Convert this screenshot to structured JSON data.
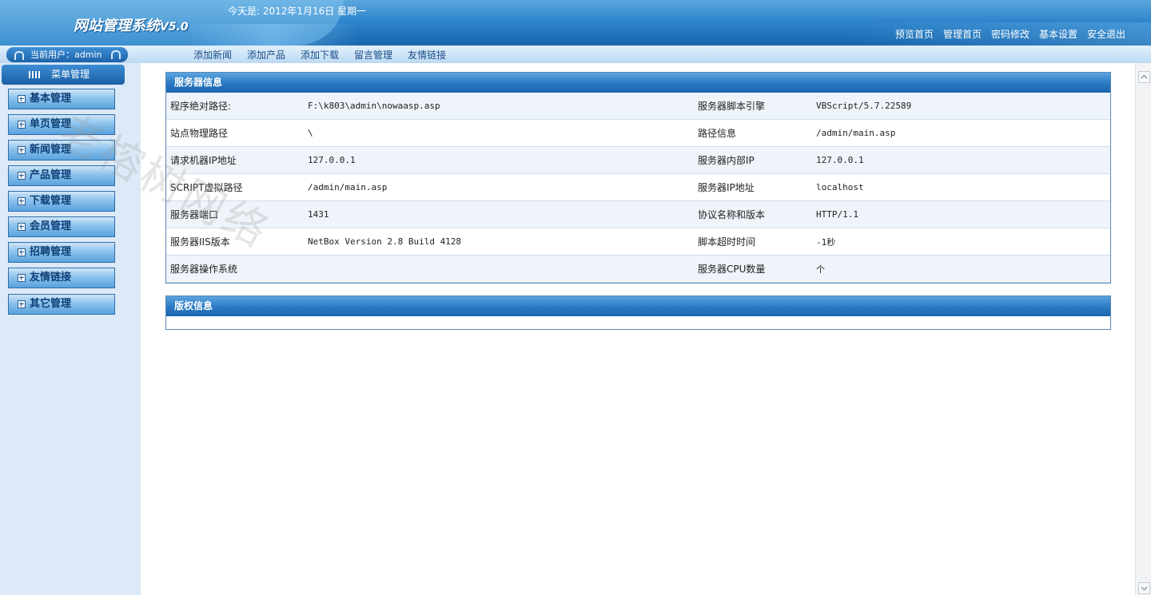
{
  "header": {
    "logo_text": "网站管理系统",
    "logo_version": "V5.0",
    "date_text": "今天是: 2012年1月16日 星期一",
    "nav": [
      "预览首页",
      "管理首页",
      "密码修改",
      "基本设置",
      "安全退出"
    ]
  },
  "user_bar": {
    "label": "当前用户：admin"
  },
  "subnav": [
    "添加新闻",
    "添加产品",
    "添加下载",
    "留言管理",
    "友情链接"
  ],
  "sidebar": {
    "title": "菜单管理",
    "items": [
      "基本管理",
      "单页管理",
      "新闻管理",
      "产品管理",
      "下载管理",
      "会员管理",
      "招聘管理",
      "友情链接",
      "其它管理"
    ]
  },
  "watermark": "老榕树网络",
  "server_panel": {
    "title": "服务器信息",
    "rows": [
      [
        "程序绝对路径:",
        "F:\\k803\\admin\\nowaasp.asp",
        "服务器脚本引擎",
        "VBScript/5.7.22589"
      ],
      [
        "站点物理路径",
        "\\",
        "路径信息",
        "/admin/main.asp"
      ],
      [
        "请求机器IP地址",
        "127.0.0.1",
        "服务器内部IP",
        "127.0.0.1"
      ],
      [
        "SCRIPT虚拟路径",
        "/admin/main.asp",
        "服务器IP地址",
        "localhost"
      ],
      [
        "服务器端口",
        "1431",
        "协议名称和版本",
        "HTTP/1.1"
      ],
      [
        "服务器IIS版本",
        "NetBox Version 2.8 Build 4128",
        "脚本超时时间",
        "-1秒"
      ],
      [
        "服务器操作系统",
        "",
        "服务器CPU数量",
        "个"
      ]
    ]
  },
  "copyright_panel": {
    "title": "版权信息"
  },
  "colors": {
    "header_blue": "#2f86cc",
    "sidebar_bg": "#dce9f7",
    "panel_header": "#2a78c2"
  }
}
